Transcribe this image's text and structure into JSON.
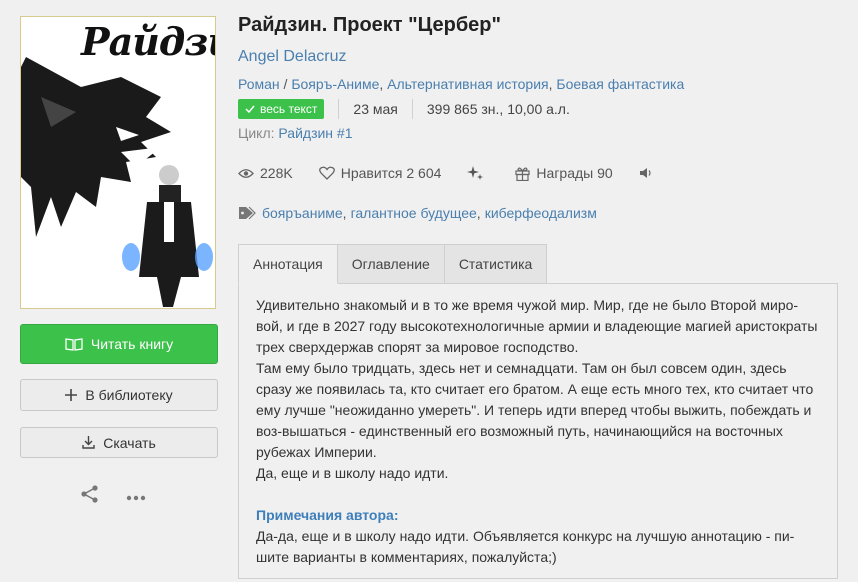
{
  "cover": {
    "title": "Райдзин"
  },
  "actions": {
    "read": "Читать книгу",
    "library": "В библиотеку",
    "download": "Скачать"
  },
  "book": {
    "title": "Райдзин. Проект \"Цербер\"",
    "author": "Angel Delacruz",
    "genres": [
      "Роман",
      "Бояръ-Аниме",
      "Альтернативная история",
      "Боевая фантастика"
    ],
    "status_badge": "весь текст",
    "date": "23 мая",
    "size": "399 865 зн., 10,00 а.л.",
    "cycle_label": "Цикл:",
    "cycle_name": "Райдзин #1"
  },
  "stats": {
    "views": "228K",
    "likes_label": "Нравится",
    "likes_count": "2 604",
    "awards_label": "Награды",
    "awards_count": "90"
  },
  "tags": [
    "бояръаниме",
    "галантное будущее",
    "киберфеодализм"
  ],
  "tabs": [
    "Аннотация",
    "Оглавление",
    "Статистика"
  ],
  "annotation": {
    "p1": "Удивительно знакомый и в то же время чужой мир. Мир, где не было Второй миро-вой, и где в 2027 году высокотехнологичные армии и владеющие магией аристократы трех сверхдержав спорят за мировое господство.",
    "p2": "Там ему было тридцать, здесь нет и семнадцати. Там он был совсем один, здесь сразу же появилась та, кто считает его братом. А еще есть много тех, кто считает что ему лучше \"неожиданно умереть\". И теперь идти вперед чтобы выжить, побеждать и воз-вышаться - единственный его возможный путь, начинающийся на восточных рубежах Империи.",
    "p3": "Да, еще и в школу надо идти.",
    "notes_heading": "Примечания автора:",
    "notes": "Да-да, еще и в школу надо идти. Объявляется конкурс на лучшую аннотацию - пи-шите варианты в комментариях, пожалуйста;)"
  },
  "colors": {
    "accent_green": "#3cc14a",
    "link_blue": "#4a7fae",
    "note_blue": "#3e7fba"
  }
}
